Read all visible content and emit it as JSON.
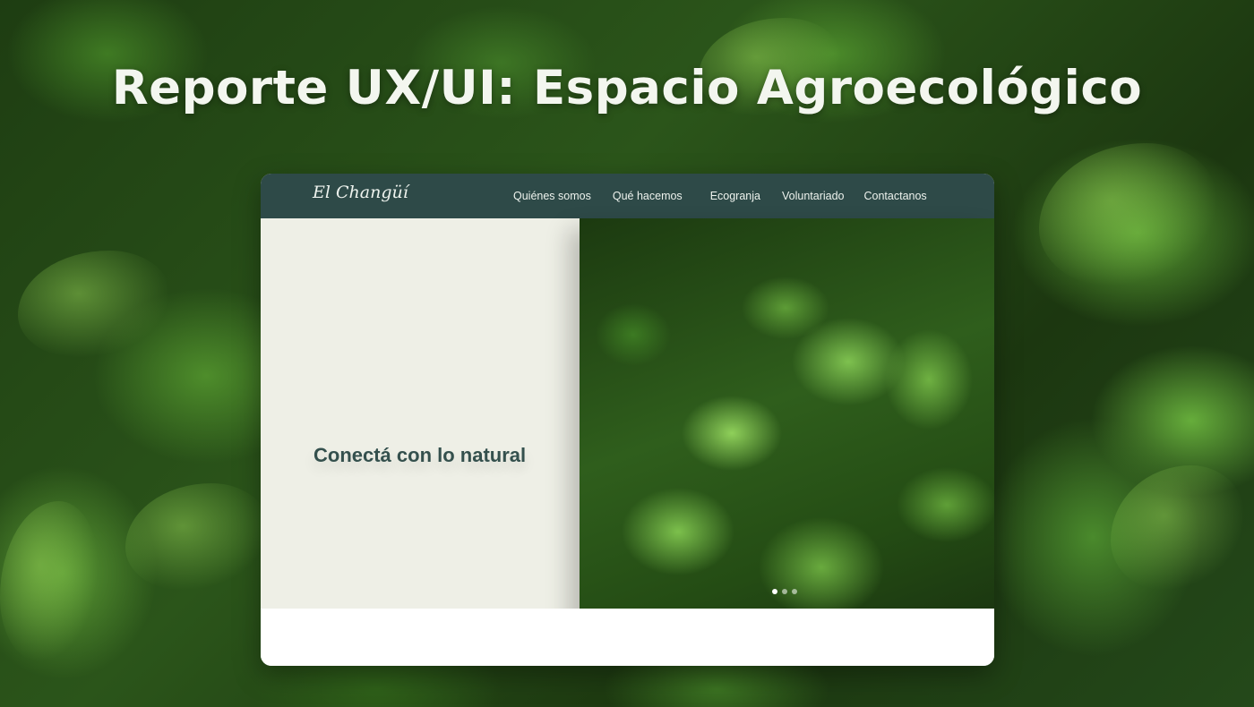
{
  "page": {
    "title": "Reporte UX/UI: Espacio Agroecológico"
  },
  "site": {
    "logo": "El Changüí",
    "nav": [
      {
        "label": "Quiénes somos"
      },
      {
        "label": "Qué hacemos"
      },
      {
        "label": "Ecogranja"
      },
      {
        "label": "Voluntariado"
      },
      {
        "label": "Contactanos"
      }
    ],
    "hero": {
      "headline": "Conectá con lo natural",
      "carousel": {
        "slides": 3,
        "active_index": 0
      }
    }
  },
  "colors": {
    "nav_bg": "#2e4a48",
    "hero_left_bg": "#eeefe6",
    "headline": "#34504d",
    "title_text": "#f3f6ef"
  }
}
